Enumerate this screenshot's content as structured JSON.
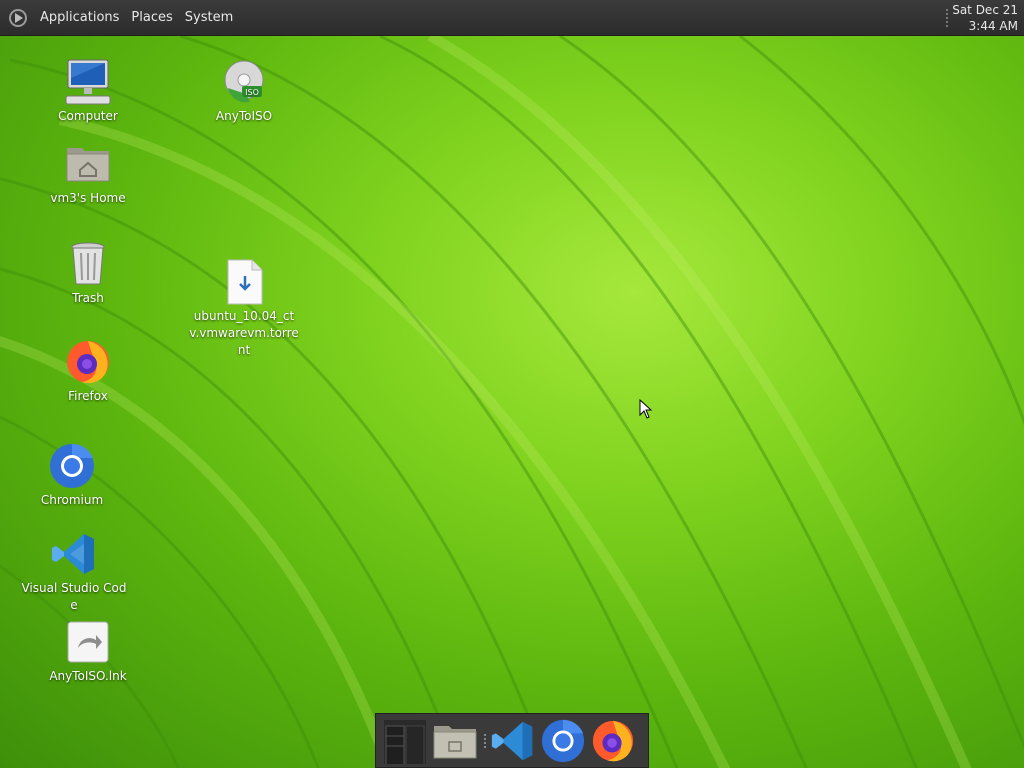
{
  "top_panel": {
    "menus": [
      "Applications",
      "Places",
      "System"
    ],
    "clock": {
      "date": "Sat Dec 21",
      "time": "3:44 AM"
    }
  },
  "desktop_icons": [
    {
      "label": "Computer",
      "icon": "computer-icon"
    },
    {
      "label": "AnyToISO",
      "icon": "anytoiso-icon"
    },
    {
      "label": "vm3's Home",
      "icon": "home-folder-icon"
    },
    {
      "label": "Trash",
      "icon": "trash-icon"
    },
    {
      "label": "ubuntu_10.04_ctv.vmwarevm.torrent",
      "icon": "torrent-file-icon"
    },
    {
      "label": "Firefox",
      "icon": "firefox-icon"
    },
    {
      "label": "Chromium",
      "icon": "chromium-icon"
    },
    {
      "label": "Visual Studio Code",
      "icon": "vscode-icon"
    },
    {
      "label": "AnyToISO.lnk",
      "icon": "shortcut-link-icon"
    }
  ],
  "dock": {
    "items": [
      "workspace-switcher-icon",
      "files-icon",
      "vscode-icon",
      "chromium-icon",
      "firefox-icon"
    ]
  },
  "colors": {
    "panel": "#2f2f2f",
    "wallpaper": "#7fd21e",
    "chromium_blue": "#3b7be8",
    "vscode_blue": "#2d8ad6"
  }
}
